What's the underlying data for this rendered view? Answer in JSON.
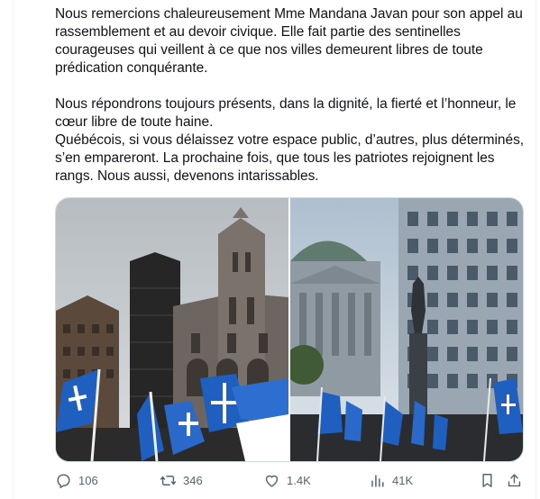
{
  "tweet": {
    "paragraph1": "Nous remercions chaleureusement Mme Mandana Javan pour son appel au rassemblement et au devoir civique. Elle fait partie des sentinelles courageuses qui veillent à ce que nos villes demeurent libres de toute prédication conquérante.",
    "paragraph2_line1": "Nous répondrons toujours présents, dans la dignité, la fierté et l’honneur, le cœur libre de toute haine.",
    "paragraph2_line2": "Québécois, si vous délaissez votre espace public, d’autres, plus déterminés, s’en empareront. La prochaine fois, que tous les patriotes rejoignent les rangs. Nous aussi, devenons intarissables."
  },
  "media": {
    "photo_left_subject": "cathedral-with-quebec-flags",
    "photo_right_subject": "plaza-with-statue-and-quebec-flags"
  },
  "actions": {
    "replies": "106",
    "reposts": "346",
    "likes": "1.4K",
    "views": "41K"
  },
  "colors": {
    "text": "#0f1419",
    "muted": "#536471",
    "border": "#cfd9de",
    "flag_blue": "#1f5fbf"
  },
  "icons": [
    "reply-icon",
    "repost-icon",
    "like-icon",
    "views-icon",
    "bookmark-icon",
    "share-icon"
  ]
}
